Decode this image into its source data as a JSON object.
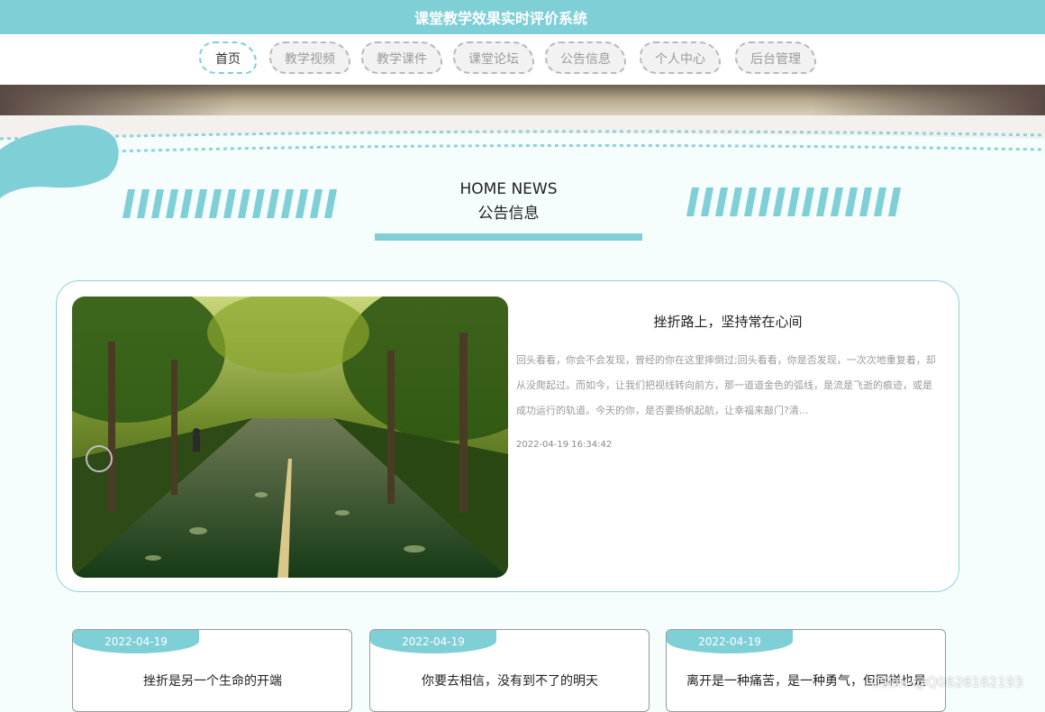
{
  "header": {
    "title": "课堂教学效果实时评价系统"
  },
  "nav": {
    "items": [
      {
        "label": "首页"
      },
      {
        "label": "教学视频"
      },
      {
        "label": "教学课件"
      },
      {
        "label": "课堂论坛"
      },
      {
        "label": "公告信息"
      },
      {
        "label": "个人中心"
      },
      {
        "label": "后台管理"
      }
    ]
  },
  "news_section": {
    "title_en": "HOME NEWS",
    "title_cn": "公告信息"
  },
  "featured": {
    "title": "挫折路上，坚持常在心间",
    "body": "回头看看，你会不会发现，曾经的你在这里摔倒过;回头看看，你是否发现，一次次地重复着，却从没爬起过。而如今，让我们把视线转向前方，那一道道金色的弧线，是流是飞逝的痕迹，或是成功运行的轨道。今天的你，是否要扬帆起航，让幸福来敲门?清...",
    "date": "2022-04-19 16:34:42"
  },
  "cards": [
    {
      "date": "2022-04-19",
      "title": "挫折是另一个生命的开端"
    },
    {
      "date": "2022-04-19",
      "title": "你要去相信，没有到不了的明天"
    },
    {
      "date": "2022-04-19",
      "title": "离开是一种痛苦，是一种勇气，但同样也是"
    }
  ],
  "watermark": "CSDN @Q0626162193",
  "colors": {
    "accent": "#7fcfd7",
    "background": "#f5fdfd"
  }
}
